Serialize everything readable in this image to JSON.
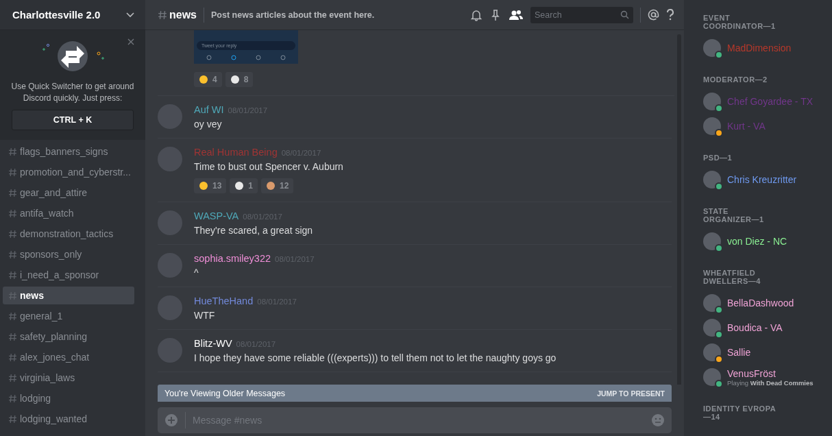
{
  "server": {
    "name": "Charlottesville 2.0"
  },
  "quick_switcher": {
    "text": "Use Quick Switcher to get around Discord quickly. Just press:",
    "shortcut": "CTRL + K"
  },
  "channels": [
    {
      "name": "flags_banners_signs",
      "selected": false
    },
    {
      "name": "promotion_and_cyberstr...",
      "selected": false
    },
    {
      "name": "gear_and_attire",
      "selected": false
    },
    {
      "name": "antifa_watch",
      "selected": false
    },
    {
      "name": "demonstration_tactics",
      "selected": false
    },
    {
      "name": "sponsors_only",
      "selected": false
    },
    {
      "name": "i_need_a_sponsor",
      "selected": false
    },
    {
      "name": "news",
      "selected": true
    },
    {
      "name": "general_1",
      "selected": false
    },
    {
      "name": "safety_planning",
      "selected": false
    },
    {
      "name": "alex_jones_chat",
      "selected": false
    },
    {
      "name": "virginia_laws",
      "selected": false
    },
    {
      "name": "lodging",
      "selected": false
    },
    {
      "name": "lodging_wanted",
      "selected": false
    }
  ],
  "channel_header": {
    "name": "news",
    "topic": "Post news articles about the event here.",
    "search_placeholder": "Search"
  },
  "messages": [
    {
      "kind": "attachment",
      "image_text": "Tweet your reply",
      "reactions": [
        {
          "count": "4"
        },
        {
          "count": "8"
        }
      ]
    },
    {
      "kind": "message",
      "author": "Auf WI",
      "color": "#4fa8b8",
      "date": "08/01/2017",
      "text": "oy vey"
    },
    {
      "kind": "message",
      "author": "Real Human Being",
      "color": "#a03434",
      "date": "08/01/2017",
      "text": "Time to bust out Spencer v. Auburn",
      "reactions": [
        {
          "count": "13"
        },
        {
          "count": "1"
        },
        {
          "count": "12"
        }
      ]
    },
    {
      "kind": "message",
      "author": "WASP-VA",
      "color": "#4fa8b8",
      "date": "08/01/2017",
      "text": "They're scared, a great sign"
    },
    {
      "kind": "message",
      "author": "sophia.smiley322",
      "color": "#f08fd8",
      "date": "08/01/2017",
      "text": "^"
    },
    {
      "kind": "message",
      "author": "HueTheHand",
      "color": "#7289da",
      "date": "08/01/2017",
      "text": "WTF"
    },
    {
      "kind": "message",
      "author": "Blitz-WV",
      "color": "#ffffff",
      "date": "08/01/2017",
      "text": "I hope they have some reliable (((experts))) to tell them not to let the naughty goys go"
    }
  ],
  "banner": {
    "text": "You're Viewing Older Messages",
    "action": "JUMP TO PRESENT"
  },
  "composer": {
    "placeholder": "Message #news"
  },
  "member_groups": [
    {
      "title": "EVENT COORDINATOR—1",
      "members": [
        {
          "name": "MadDimension",
          "color": "#b8382a",
          "idle": false
        }
      ]
    },
    {
      "title": "MODERATOR—2",
      "members": [
        {
          "name": "Chef Goyardee - TX",
          "color": "#71368a",
          "idle": false
        },
        {
          "name": "Kurt - VA",
          "color": "#71368a",
          "idle": true
        }
      ]
    },
    {
      "title": "PSD—1",
      "members": [
        {
          "name": "Chris Kreuzritter",
          "color": "#6f9af0",
          "idle": false
        }
      ]
    },
    {
      "title": "STATE ORGANIZER—1",
      "members": [
        {
          "name": "von Diez - NC",
          "color": "#8bf093",
          "idle": false
        }
      ]
    },
    {
      "title": "WHEATFIELD DWELLERS—4",
      "members": [
        {
          "name": "BellaDashwood",
          "color": "#f0a3d6",
          "idle": false
        },
        {
          "name": "Boudica - VA",
          "color": "#f0a3d6",
          "idle": false
        },
        {
          "name": "Sallie",
          "color": "#f0a3d6",
          "idle": true
        },
        {
          "name": "VenusFröst",
          "color": "#f0a3d6",
          "idle": false,
          "activity": "Playing **With Dead Commies**"
        }
      ]
    },
    {
      "title": "IDENTITY EVROPA—14"
    }
  ]
}
